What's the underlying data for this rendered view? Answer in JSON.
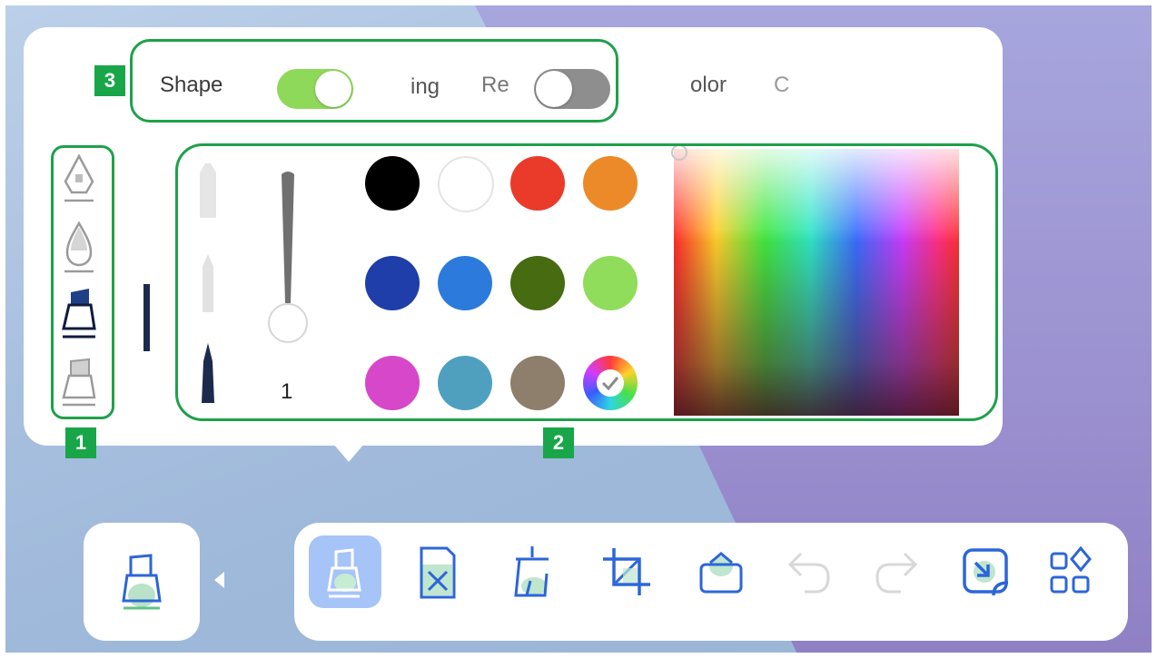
{
  "options_bar": {
    "shape_label": "Shape",
    "shape_toggle": "on",
    "item2_label": "ing",
    "item3_label": "Re",
    "item3_toggle": "off",
    "item4_label": "olor",
    "item5_label": "C"
  },
  "callouts": {
    "pen_types_badge": "1",
    "color_panel_badge": "2",
    "options_badge": "3"
  },
  "pen_types": [
    {
      "icon": "fountain-pen-icon",
      "selected": false
    },
    {
      "icon": "brush-pen-icon",
      "selected": false
    },
    {
      "icon": "marker-pen-icon",
      "selected": true
    },
    {
      "icon": "highlighter-pen-icon",
      "selected": false
    }
  ],
  "thickness": {
    "value": "1"
  },
  "colors": {
    "accent": "#1ea14a",
    "swatches": [
      {
        "name": "black",
        "hex": "#000000"
      },
      {
        "name": "white",
        "hex": "#ffffff"
      },
      {
        "name": "red",
        "hex": "#ea3b2a"
      },
      {
        "name": "orange",
        "hex": "#ec8a29"
      },
      {
        "name": "dark-blue",
        "hex": "#1f3eaa"
      },
      {
        "name": "blue",
        "hex": "#2c7bdc"
      },
      {
        "name": "dark-green",
        "hex": "#466b10"
      },
      {
        "name": "light-green",
        "hex": "#8fdd5a"
      },
      {
        "name": "magenta",
        "hex": "#d648c9"
      },
      {
        "name": "teal",
        "hex": "#4fa0bf"
      },
      {
        "name": "taupe",
        "hex": "#8e7f6c"
      },
      {
        "name": "custom",
        "hex": "rainbow"
      }
    ]
  },
  "toolbar": {
    "tools": [
      {
        "icon": "pen-tool-icon",
        "active": true
      },
      {
        "icon": "eraser-icon",
        "active": false
      },
      {
        "icon": "clear-icon",
        "active": false
      },
      {
        "icon": "crop-icon",
        "active": false
      },
      {
        "icon": "shape-icon",
        "active": false
      },
      {
        "icon": "undo-icon",
        "active": false
      },
      {
        "icon": "redo-icon",
        "active": false
      },
      {
        "icon": "minimize-icon",
        "active": false
      },
      {
        "icon": "more-apps-icon",
        "active": false
      }
    ]
  }
}
